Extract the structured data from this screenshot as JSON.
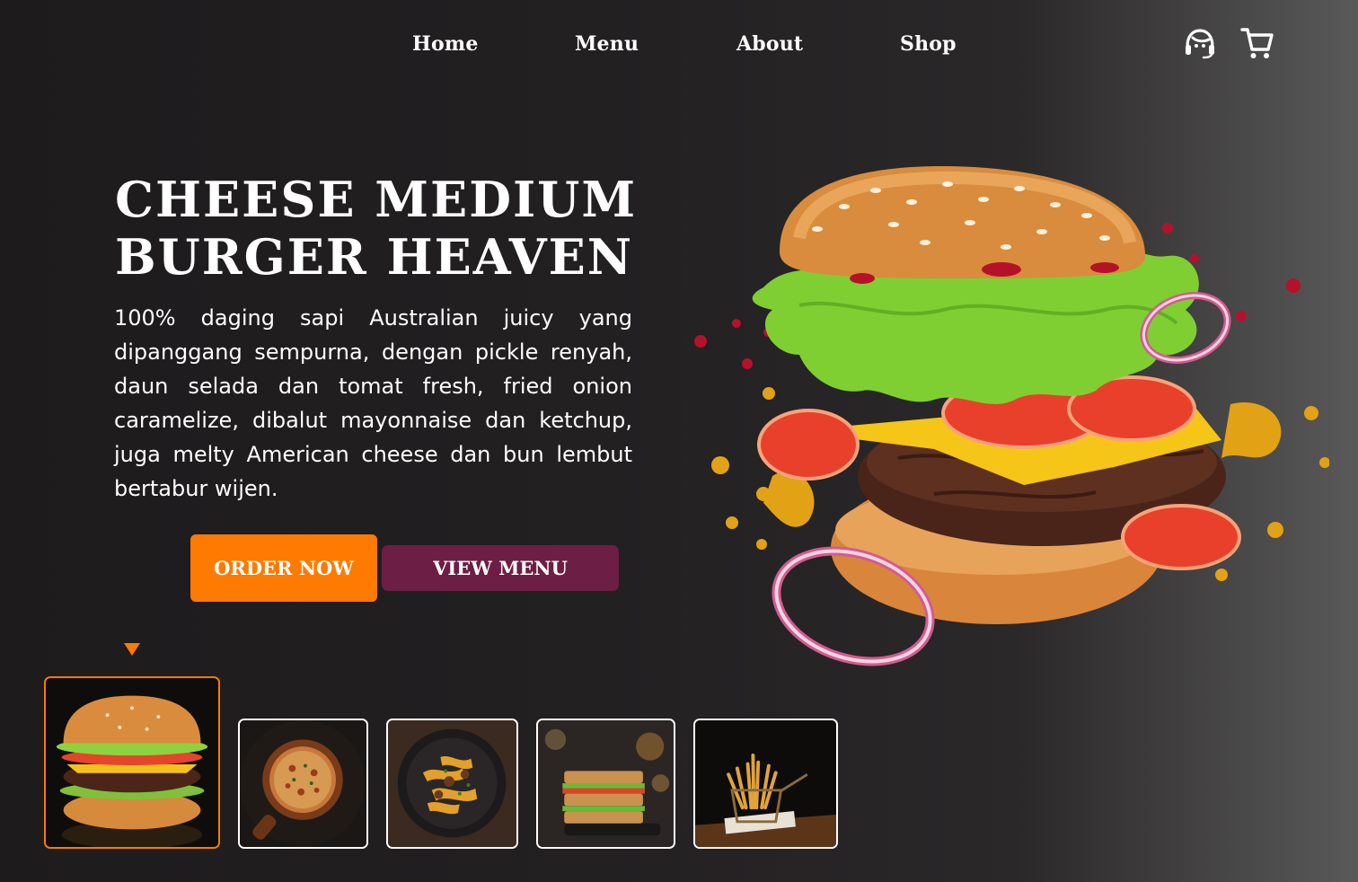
{
  "nav": {
    "links": [
      "Home",
      "Menu",
      "About",
      "Shop"
    ],
    "icons": [
      "customer-support-icon",
      "shopping-cart-icon"
    ]
  },
  "hero": {
    "title_line1": "CHEESE MEDIUM",
    "title_line2": "BURGER HEAVEN",
    "description": "100% daging sapi Australian juicy yang dipanggang sempurna, dengan pickle renyah, daun selada dan tomat fresh, fried onion caramelize, dibalut mayonnaise dan ketchup, juga melty American cheese dan bun lembut bertabur wijen.",
    "order_button": "ORDER NOW",
    "menu_button": "VIEW MENU",
    "image": "flying-burger-image"
  },
  "thumbnails": {
    "items": [
      "burger",
      "pizza",
      "pasta",
      "sandwich",
      "fries"
    ],
    "active_index": 0
  },
  "colors": {
    "accent": "#ff7a00",
    "secondary": "#6d1e45",
    "background": "#1d1b1c"
  }
}
